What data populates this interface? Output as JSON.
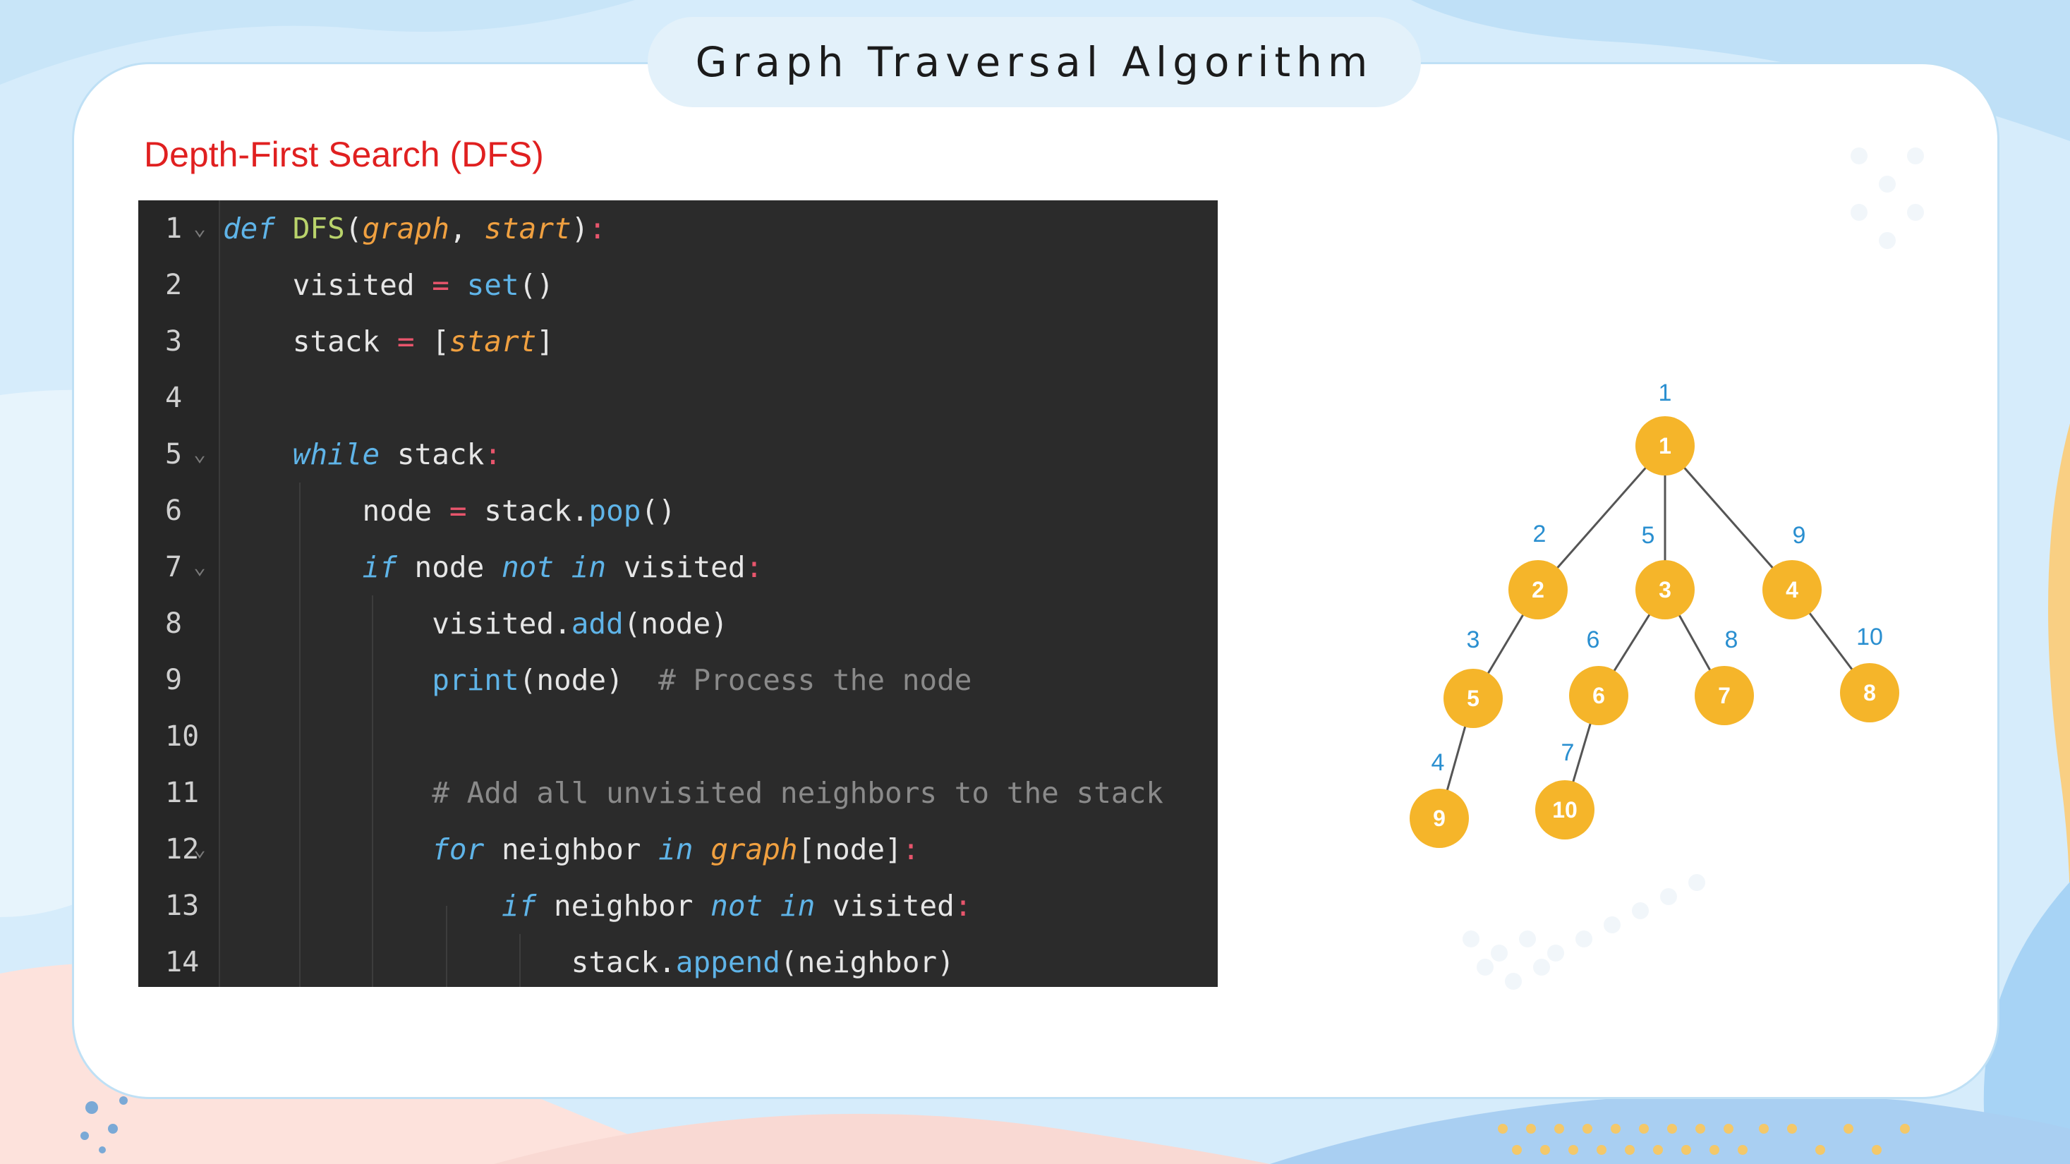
{
  "title": "Graph Traversal Algorithm",
  "subtitle": "Depth-First Search (DFS)",
  "code": {
    "line_numbers": [
      "1",
      "2",
      "3",
      "4",
      "5",
      "6",
      "7",
      "8",
      "9",
      "10",
      "11",
      "12",
      "13",
      "14"
    ],
    "lines": [
      {
        "tokens": [
          [
            "kw",
            "def"
          ],
          [
            "plain",
            " "
          ],
          [
            "fn",
            "DFS"
          ],
          [
            "plain",
            "("
          ],
          [
            "param",
            "graph"
          ],
          [
            "plain",
            ", "
          ],
          [
            "param",
            "start"
          ],
          [
            "plain",
            ")"
          ],
          [
            "punct-r",
            ":"
          ]
        ]
      },
      {
        "tokens": [
          [
            "plain",
            "    visited "
          ],
          [
            "punct-r",
            "="
          ],
          [
            "plain",
            " "
          ],
          [
            "builtin",
            "set"
          ],
          [
            "plain",
            "()"
          ]
        ]
      },
      {
        "tokens": [
          [
            "plain",
            "    stack "
          ],
          [
            "punct-r",
            "="
          ],
          [
            "plain",
            " ["
          ],
          [
            "param",
            "start"
          ],
          [
            "plain",
            "]"
          ]
        ]
      },
      {
        "tokens": []
      },
      {
        "tokens": [
          [
            "plain",
            "    "
          ],
          [
            "kw",
            "while"
          ],
          [
            "plain",
            " stack"
          ],
          [
            "punct-r",
            ":"
          ]
        ]
      },
      {
        "tokens": [
          [
            "plain",
            "        node "
          ],
          [
            "punct-r",
            "="
          ],
          [
            "plain",
            " stack."
          ],
          [
            "method",
            "pop"
          ],
          [
            "plain",
            "()"
          ]
        ]
      },
      {
        "tokens": [
          [
            "plain",
            "        "
          ],
          [
            "kw",
            "if"
          ],
          [
            "plain",
            " node "
          ],
          [
            "kw",
            "not in"
          ],
          [
            "plain",
            " visited"
          ],
          [
            "punct-r",
            ":"
          ]
        ]
      },
      {
        "tokens": [
          [
            "plain",
            "            visited."
          ],
          [
            "method",
            "add"
          ],
          [
            "plain",
            "(node)"
          ]
        ]
      },
      {
        "tokens": [
          [
            "plain",
            "            "
          ],
          [
            "builtin",
            "print"
          ],
          [
            "plain",
            "(node)  "
          ],
          [
            "comment",
            "# Process the node"
          ]
        ]
      },
      {
        "tokens": []
      },
      {
        "tokens": [
          [
            "plain",
            "            "
          ],
          [
            "comment",
            "# Add all unvisited neighbors to the stack"
          ]
        ]
      },
      {
        "tokens": [
          [
            "plain",
            "            "
          ],
          [
            "kw",
            "for"
          ],
          [
            "plain",
            " neighbor "
          ],
          [
            "kw",
            "in"
          ],
          [
            "plain",
            " "
          ],
          [
            "param",
            "graph"
          ],
          [
            "plain",
            "[node]"
          ],
          [
            "punct-r",
            ":"
          ]
        ]
      },
      {
        "tokens": [
          [
            "plain",
            "                "
          ],
          [
            "kw",
            "if"
          ],
          [
            "plain",
            " neighbor "
          ],
          [
            "kw",
            "not in"
          ],
          [
            "plain",
            " visited"
          ],
          [
            "punct-r",
            ":"
          ]
        ]
      },
      {
        "tokens": [
          [
            "plain",
            "                    stack."
          ],
          [
            "method",
            "append"
          ],
          [
            "plain",
            "(neighbor)"
          ]
        ]
      }
    ],
    "fold_lines": [
      1,
      5,
      7,
      12
    ]
  },
  "tree": {
    "nodes": [
      {
        "id": "1",
        "label": "1"
      },
      {
        "id": "2",
        "label": "2"
      },
      {
        "id": "3",
        "label": "3"
      },
      {
        "id": "4",
        "label": "4"
      },
      {
        "id": "5",
        "label": "5"
      },
      {
        "id": "6",
        "label": "6"
      },
      {
        "id": "7",
        "label": "7"
      },
      {
        "id": "8",
        "label": "8"
      },
      {
        "id": "9",
        "label": "9"
      },
      {
        "id": "10",
        "label": "10"
      }
    ],
    "visit_order": [
      {
        "node": "1",
        "order": "1"
      },
      {
        "node": "2",
        "order": "2"
      },
      {
        "node": "5",
        "order": "3"
      },
      {
        "node": "9",
        "order": "4"
      },
      {
        "node": "3",
        "order": "5"
      },
      {
        "node": "6",
        "order": "6"
      },
      {
        "node": "10",
        "order": "7"
      },
      {
        "node": "7",
        "order": "8"
      },
      {
        "node": "4",
        "order": "9"
      },
      {
        "node": "8",
        "order": "10"
      }
    ],
    "edges": [
      [
        "1",
        "2"
      ],
      [
        "1",
        "3"
      ],
      [
        "1",
        "4"
      ],
      [
        "2",
        "5"
      ],
      [
        "3",
        "6"
      ],
      [
        "3",
        "7"
      ],
      [
        "4",
        "8"
      ],
      [
        "5",
        "9"
      ],
      [
        "6",
        "10"
      ]
    ],
    "node_color": "#f5b52a",
    "edge_color": "#555555",
    "order_color": "#2a8fd0"
  }
}
